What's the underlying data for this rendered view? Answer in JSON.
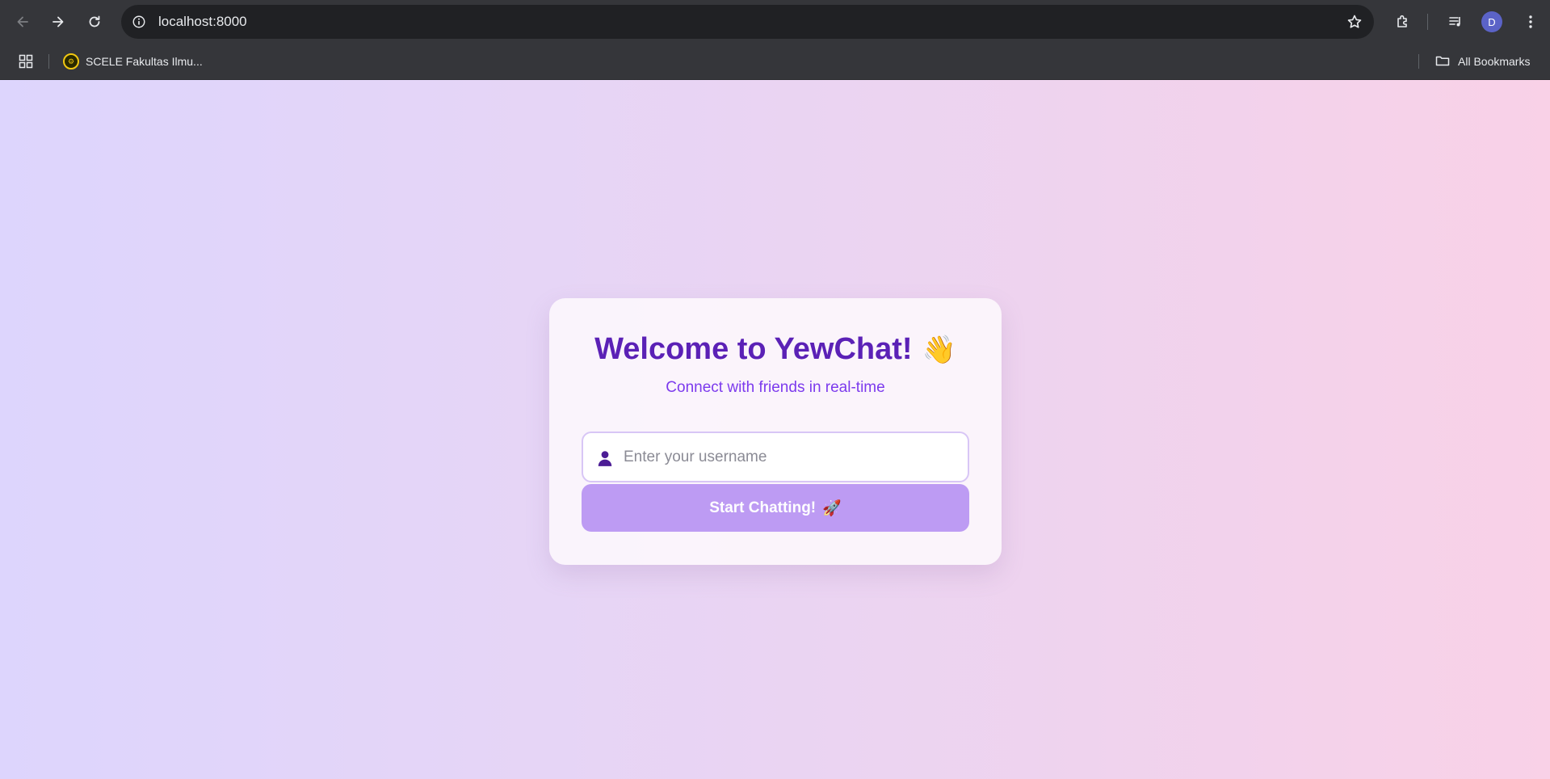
{
  "browser": {
    "url": "localhost:8000",
    "avatar_initial": "D",
    "bookmarks": [
      {
        "label": "SCELE Fakultas Ilmu..."
      }
    ],
    "all_bookmarks_label": "All Bookmarks"
  },
  "page": {
    "title": "Welcome to YewChat!",
    "title_emoji": "👋",
    "subtitle": "Connect with friends in real-time",
    "username_placeholder": "Enter your username",
    "start_button_label": "Start Chatting!",
    "start_button_emoji": "🚀"
  },
  "colors": {
    "title": "#5b21b6",
    "subtitle": "#7c3aed",
    "button": "#bd9bf3",
    "input_border": "#d8c6f6"
  }
}
